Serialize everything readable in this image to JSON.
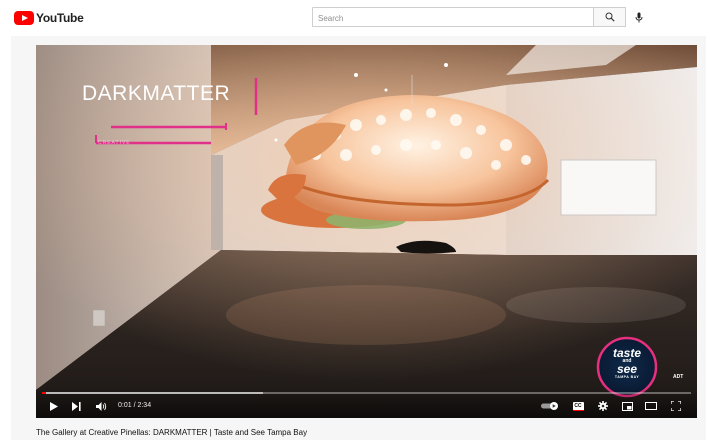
{
  "header": {
    "logo_text": "YouTube",
    "search_placeholder": "Search"
  },
  "video": {
    "overlay_title": "DARKMATTER",
    "overlay_subtitle": "CREATIVE",
    "badge": {
      "line1": "taste",
      "line2": "and",
      "line3": "see",
      "line4": "TAMPA BAY"
    },
    "time_display": "0:01 / 2:34",
    "progress_fraction": 0.006,
    "buffer_fraction": 0.34,
    "cc_label": "CC",
    "accent_color": "#ff0000"
  },
  "caption": "The Gallery at Creative Pinellas: DARKMATTER | Taste and See Tampa Bay"
}
